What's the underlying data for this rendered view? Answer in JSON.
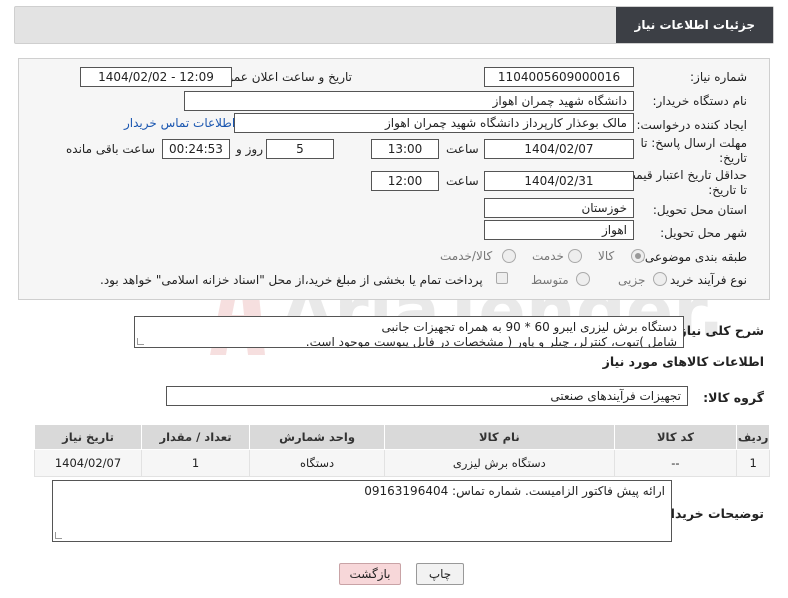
{
  "header": {
    "title": "جزئیات اطلاعات نیاز"
  },
  "form": {
    "need_number": {
      "label": "شماره نیاز:",
      "value": "1104005609000016"
    },
    "announce_datetime": {
      "label": "تاریخ و ساعت اعلان عمومی:",
      "value": "1404/02/02 - 12:09"
    },
    "buyer_org": {
      "label": "نام دستگاه خریدار:",
      "value": "دانشگاه شهید چمران اهواز"
    },
    "requester": {
      "label": "ایجاد کننده درخواست:",
      "value": "مالک بوعذار کارپرداز دانشگاه شهید چمران اهواز",
      "contact_link": "اطلاعات تماس خریدار"
    },
    "reply_deadline": {
      "label_line1": "مهلت ارسال پاسخ: تا",
      "label_line2": "تاریخ:",
      "date": "1404/02/07",
      "time_label": "ساعت",
      "time": "13:00",
      "days": "5",
      "days_label": "روز و",
      "remaining": "00:24:53",
      "remaining_label": "ساعت باقی مانده"
    },
    "price_validity": {
      "label_line1": "حداقل تاریخ اعتبار قیمت:",
      "label_line2": "تا تاریخ:",
      "date": "1404/02/31",
      "time_label": "ساعت",
      "time": "12:00"
    },
    "delivery_province": {
      "label": "استان محل تحویل:",
      "value": "خوزستان"
    },
    "delivery_city": {
      "label": "شهر محل تحویل:",
      "value": "اهواز"
    },
    "category": {
      "label": "طبقه بندی موضوعی:",
      "options": [
        "کالا",
        "خدمت",
        "کالا/خدمت"
      ],
      "selected": "کالا"
    },
    "purchase_type": {
      "label": "نوع فرآیند خرید :",
      "options": [
        "جزیی",
        "متوسط"
      ],
      "checkbox_text": "پرداخت تمام یا بخشی از مبلغ خرید،از محل \"اسناد خزانه اسلامی\" خواهد بود."
    }
  },
  "description": {
    "label": "شرح کلی نیاز:",
    "line1": "دستگاه برش لیزری ایبرو 60 * 90 به همراه تجهیزات جانبی",
    "line2": "شامل )تیوب، کنترلر، چیلر و پاور ( مشخصات در فایل پیوست موجود است."
  },
  "goods": {
    "section_title": "اطلاعات کالاهای مورد نیاز",
    "group_label": "گروه کالا:",
    "group_value": "تجهیزات فرآیندهای صنعتی",
    "columns": [
      "ردیف",
      "کد کالا",
      "نام کالا",
      "واحد شمارش",
      "تعداد / مقدار",
      "تاریخ نیاز"
    ],
    "rows": [
      [
        "1",
        "--",
        "دستگاه برش لیزری",
        "دستگاه",
        "1",
        "1404/02/07"
      ]
    ]
  },
  "buyer_notes": {
    "label": "توضیحات خریدار:",
    "text": "ارائه پیش فاکتور الزامیست. شماره تماس: 09163196404"
  },
  "buttons": {
    "print": "چاپ",
    "back": "بازگشت"
  },
  "watermark": {
    "text": "AriaTender.net"
  }
}
